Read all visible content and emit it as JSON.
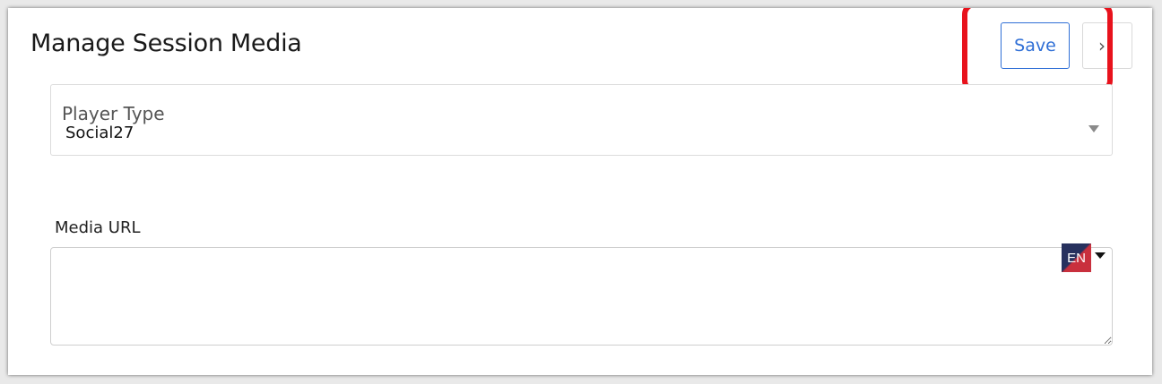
{
  "header": {
    "title": "Manage Session Media",
    "save_label": "Save",
    "next_icon": "chevron-right-icon",
    "next_glyph": "›"
  },
  "player_type": {
    "label": "Player Type",
    "value": "Social27"
  },
  "media_url": {
    "label": "Media URL",
    "value": "",
    "language_badge": "EN"
  },
  "colors": {
    "accent": "#2f6fd6",
    "highlight": "#e8121c",
    "badge_dark": "#27315e",
    "badge_red": "#c9303d"
  }
}
